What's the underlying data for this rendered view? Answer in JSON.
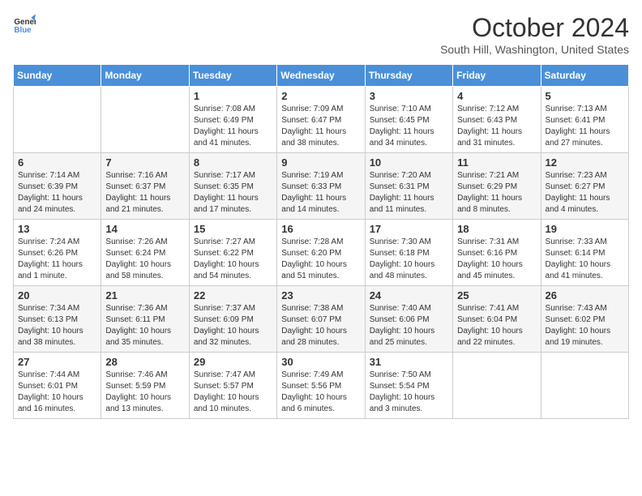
{
  "header": {
    "logo_line1": "General",
    "logo_line2": "Blue",
    "month_title": "October 2024",
    "subtitle": "South Hill, Washington, United States"
  },
  "days_of_week": [
    "Sunday",
    "Monday",
    "Tuesday",
    "Wednesday",
    "Thursday",
    "Friday",
    "Saturday"
  ],
  "weeks": [
    [
      {
        "day": "",
        "content": ""
      },
      {
        "day": "",
        "content": ""
      },
      {
        "day": "1",
        "content": "Sunrise: 7:08 AM\nSunset: 6:49 PM\nDaylight: 11 hours and 41 minutes."
      },
      {
        "day": "2",
        "content": "Sunrise: 7:09 AM\nSunset: 6:47 PM\nDaylight: 11 hours and 38 minutes."
      },
      {
        "day": "3",
        "content": "Sunrise: 7:10 AM\nSunset: 6:45 PM\nDaylight: 11 hours and 34 minutes."
      },
      {
        "day": "4",
        "content": "Sunrise: 7:12 AM\nSunset: 6:43 PM\nDaylight: 11 hours and 31 minutes."
      },
      {
        "day": "5",
        "content": "Sunrise: 7:13 AM\nSunset: 6:41 PM\nDaylight: 11 hours and 27 minutes."
      }
    ],
    [
      {
        "day": "6",
        "content": "Sunrise: 7:14 AM\nSunset: 6:39 PM\nDaylight: 11 hours and 24 minutes."
      },
      {
        "day": "7",
        "content": "Sunrise: 7:16 AM\nSunset: 6:37 PM\nDaylight: 11 hours and 21 minutes."
      },
      {
        "day": "8",
        "content": "Sunrise: 7:17 AM\nSunset: 6:35 PM\nDaylight: 11 hours and 17 minutes."
      },
      {
        "day": "9",
        "content": "Sunrise: 7:19 AM\nSunset: 6:33 PM\nDaylight: 11 hours and 14 minutes."
      },
      {
        "day": "10",
        "content": "Sunrise: 7:20 AM\nSunset: 6:31 PM\nDaylight: 11 hours and 11 minutes."
      },
      {
        "day": "11",
        "content": "Sunrise: 7:21 AM\nSunset: 6:29 PM\nDaylight: 11 hours and 8 minutes."
      },
      {
        "day": "12",
        "content": "Sunrise: 7:23 AM\nSunset: 6:27 PM\nDaylight: 11 hours and 4 minutes."
      }
    ],
    [
      {
        "day": "13",
        "content": "Sunrise: 7:24 AM\nSunset: 6:26 PM\nDaylight: 11 hours and 1 minute."
      },
      {
        "day": "14",
        "content": "Sunrise: 7:26 AM\nSunset: 6:24 PM\nDaylight: 10 hours and 58 minutes."
      },
      {
        "day": "15",
        "content": "Sunrise: 7:27 AM\nSunset: 6:22 PM\nDaylight: 10 hours and 54 minutes."
      },
      {
        "day": "16",
        "content": "Sunrise: 7:28 AM\nSunset: 6:20 PM\nDaylight: 10 hours and 51 minutes."
      },
      {
        "day": "17",
        "content": "Sunrise: 7:30 AM\nSunset: 6:18 PM\nDaylight: 10 hours and 48 minutes."
      },
      {
        "day": "18",
        "content": "Sunrise: 7:31 AM\nSunset: 6:16 PM\nDaylight: 10 hours and 45 minutes."
      },
      {
        "day": "19",
        "content": "Sunrise: 7:33 AM\nSunset: 6:14 PM\nDaylight: 10 hours and 41 minutes."
      }
    ],
    [
      {
        "day": "20",
        "content": "Sunrise: 7:34 AM\nSunset: 6:13 PM\nDaylight: 10 hours and 38 minutes."
      },
      {
        "day": "21",
        "content": "Sunrise: 7:36 AM\nSunset: 6:11 PM\nDaylight: 10 hours and 35 minutes."
      },
      {
        "day": "22",
        "content": "Sunrise: 7:37 AM\nSunset: 6:09 PM\nDaylight: 10 hours and 32 minutes."
      },
      {
        "day": "23",
        "content": "Sunrise: 7:38 AM\nSunset: 6:07 PM\nDaylight: 10 hours and 28 minutes."
      },
      {
        "day": "24",
        "content": "Sunrise: 7:40 AM\nSunset: 6:06 PM\nDaylight: 10 hours and 25 minutes."
      },
      {
        "day": "25",
        "content": "Sunrise: 7:41 AM\nSunset: 6:04 PM\nDaylight: 10 hours and 22 minutes."
      },
      {
        "day": "26",
        "content": "Sunrise: 7:43 AM\nSunset: 6:02 PM\nDaylight: 10 hours and 19 minutes."
      }
    ],
    [
      {
        "day": "27",
        "content": "Sunrise: 7:44 AM\nSunset: 6:01 PM\nDaylight: 10 hours and 16 minutes."
      },
      {
        "day": "28",
        "content": "Sunrise: 7:46 AM\nSunset: 5:59 PM\nDaylight: 10 hours and 13 minutes."
      },
      {
        "day": "29",
        "content": "Sunrise: 7:47 AM\nSunset: 5:57 PM\nDaylight: 10 hours and 10 minutes."
      },
      {
        "day": "30",
        "content": "Sunrise: 7:49 AM\nSunset: 5:56 PM\nDaylight: 10 hours and 6 minutes."
      },
      {
        "day": "31",
        "content": "Sunrise: 7:50 AM\nSunset: 5:54 PM\nDaylight: 10 hours and 3 minutes."
      },
      {
        "day": "",
        "content": ""
      },
      {
        "day": "",
        "content": ""
      }
    ]
  ]
}
